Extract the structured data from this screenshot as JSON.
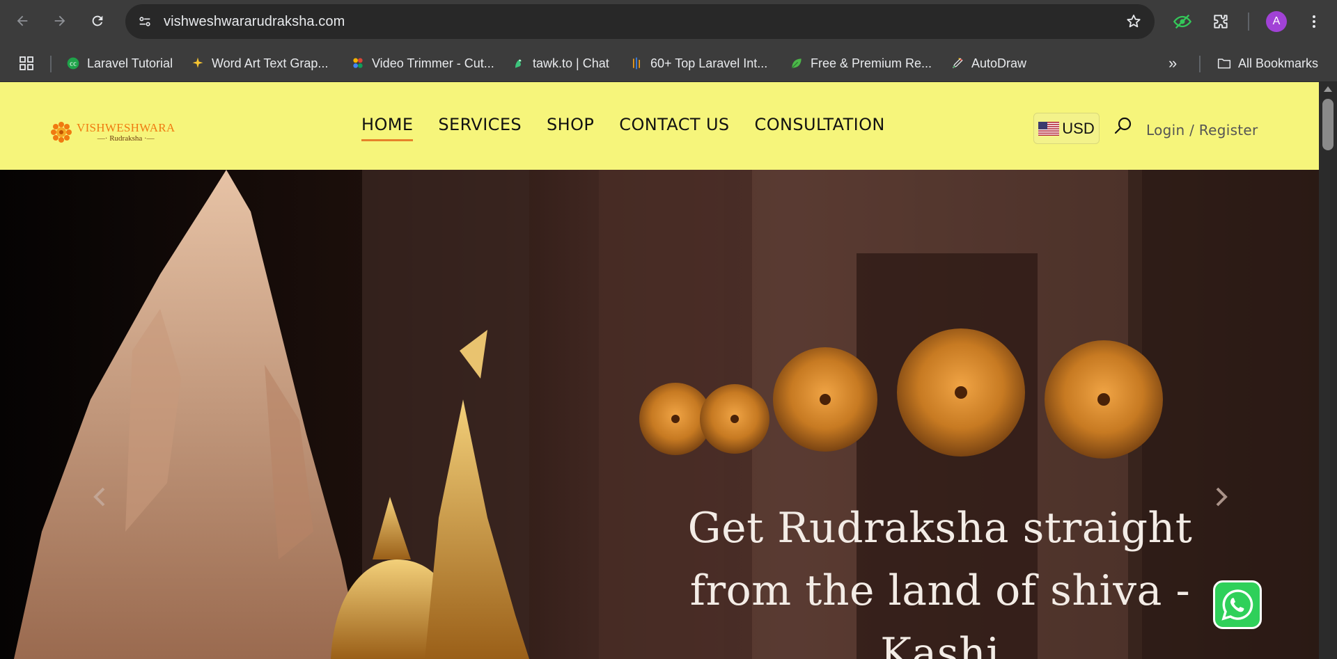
{
  "browser": {
    "url": "vishweshwararudraksha.com",
    "profile_initial": "A",
    "icons": [
      "back-icon",
      "forward-icon",
      "reload-icon",
      "site-info-icon",
      "bookmark-star-icon",
      "eye-extension-icon",
      "extensions-puzzle-icon",
      "more-menu-icon"
    ]
  },
  "bookmarks": {
    "items": [
      {
        "label": "Laravel Tutorial"
      },
      {
        "label": "Word Art Text Grap..."
      },
      {
        "label": "Video Trimmer - Cut..."
      },
      {
        "label": "tawk.to | Chat"
      },
      {
        "label": "60+ Top Laravel Int..."
      },
      {
        "label": "Free & Premium Re..."
      },
      {
        "label": "AutoDraw"
      }
    ],
    "overflow": "»",
    "all_bookmarks": "All Bookmarks"
  },
  "site": {
    "logo": {
      "title": "VISHWESHWARA",
      "subtitle": "Rudraksha"
    },
    "nav": [
      {
        "label": "HOME",
        "active": true
      },
      {
        "label": "SERVICES",
        "active": false
      },
      {
        "label": "SHOP",
        "active": false
      },
      {
        "label": "CONTACT US",
        "active": false
      },
      {
        "label": "CONSULTATION",
        "active": false
      }
    ],
    "currency": "USD",
    "login": "Login / Register",
    "header_color": "#f6f57b",
    "accent_color": "#e6832a"
  },
  "hero": {
    "line1": "Get Rudraksha straight",
    "line2": "from the land of shiva - Kashi"
  }
}
